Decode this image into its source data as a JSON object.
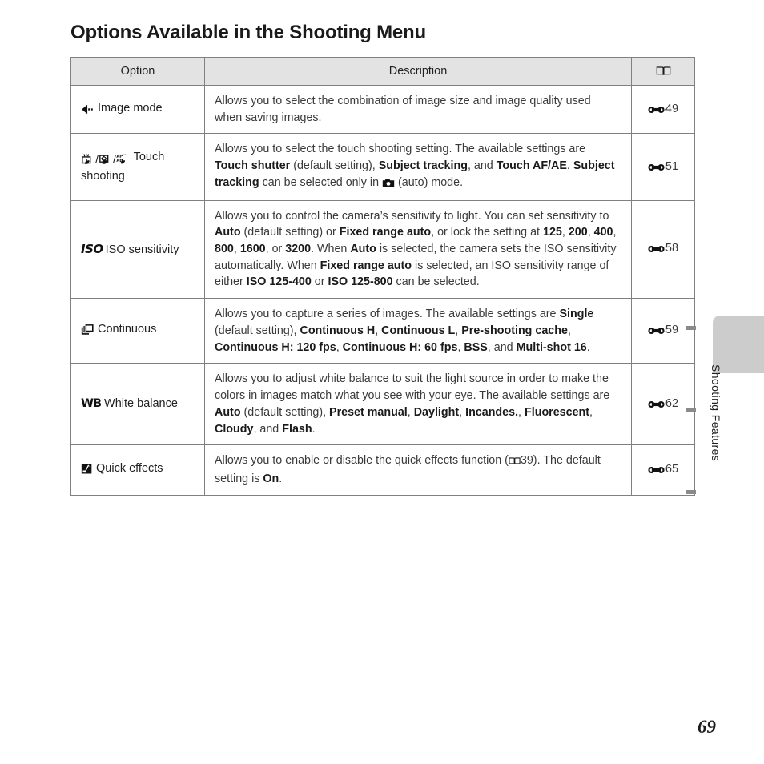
{
  "page": {
    "title": "Options Available in the Shooting Menu",
    "number": "69"
  },
  "side_tab": {
    "label": "Shooting Features"
  },
  "table": {
    "headers": {
      "option": "Option",
      "description": "Description",
      "reference": "book-icon"
    },
    "rows": [
      {
        "icon": "image-mode-icon",
        "option_label": "Image mode",
        "description_text": "Allows you to select the combination of image size and image quality used when saving images.",
        "reference": "49"
      },
      {
        "icon": "touch-shooting-icons",
        "option_label": "Touch shooting",
        "description_text": "Allows you to select the touch shooting setting. The available settings are Touch shutter (default setting), Subject tracking, and Touch AF/AE. Subject tracking can be selected only in (auto) mode.",
        "description_parts": [
          {
            "t": "Allows you to select the touch shooting setting. The available settings are ",
            "b": false
          },
          {
            "t": "Touch shutter",
            "b": true
          },
          {
            "t": " (default setting), ",
            "b": false
          },
          {
            "t": "Subject tracking",
            "b": true
          },
          {
            "t": ", and ",
            "b": false
          },
          {
            "t": "Touch AF/AE",
            "b": true
          },
          {
            "t": ". ",
            "b": false
          },
          {
            "t": "Subject tracking",
            "b": true
          },
          {
            "t": " can be selected only in ",
            "b": false
          },
          {
            "t": "[camera-icon]",
            "b": false
          },
          {
            "t": " (auto) mode.",
            "b": false
          }
        ],
        "reference": "51"
      },
      {
        "icon": "iso-icon",
        "option_label": "ISO sensitivity",
        "description_text": "Allows you to control the camera's sensitivity to light. You can set sensitivity to Auto (default setting) or Fixed range auto, or lock the setting at 125, 200, 400, 800, 1600, or 3200. When Auto is selected, the camera sets the ISO sensitivity automatically. When Fixed range auto is selected, an ISO sensitivity range of either ISO 125-400 or ISO 125-800 can be selected.",
        "reference": "58"
      },
      {
        "icon": "continuous-icon",
        "option_label": "Continuous",
        "description_text": "Allows you to capture a series of images. The available settings are Single (default setting), Continuous H, Continuous L, Pre-shooting cache, Continuous H: 120 fps, Continuous H: 60 fps, BSS, and Multi-shot 16.",
        "reference": "59"
      },
      {
        "icon": "white-balance-icon",
        "option_label": "White balance",
        "description_text": "Allows you to adjust white balance to suit the light source in order to make the colors in images match what you see with your eye. The available settings are Auto (default setting), Preset manual, Daylight, Incandes., Fluorescent, Cloudy, and Flash.",
        "reference": "62"
      },
      {
        "icon": "quick-effects-icon",
        "option_label": "Quick effects",
        "description_text": "Allows you to enable or disable the quick effects function (39). The default setting is On.",
        "inline_reference": "39",
        "reference": "65"
      }
    ]
  },
  "text_fragments": {
    "r1_d": "Allows you to select the combination of image size and image quality used when saving images.",
    "r2_p1": "Allows you to select the touch shooting setting. The available settings are ",
    "r2_b1": "Touch shutter",
    "r2_p2": " (default setting), ",
    "r2_b2": "Subject tracking",
    "r2_p3": ", and ",
    "r2_b3": "Touch AF/AE",
    "r2_p4": ". ",
    "r2_b4": "Subject tracking",
    "r2_p5": " can be selected only in ",
    "r2_p6": " (auto) mode.",
    "r3_p1": "Allows you to control the camera’s sensitivity to light. You can set sensitivity to ",
    "r3_b1": "Auto",
    "r3_p2": " (default setting) or ",
    "r3_b2": "Fixed range auto",
    "r3_p3": ", or lock the setting at ",
    "r3_b3": "125",
    "r3_p4": ", ",
    "r3_b4": "200",
    "r3_p5": ", ",
    "r3_b5": "400",
    "r3_p6": ", ",
    "r3_b6": "800",
    "r3_p7": ", ",
    "r3_b7": "1600",
    "r3_p8": ", or ",
    "r3_b8": "3200",
    "r3_p9": ". When ",
    "r3_b9": "Auto",
    "r3_p10": " is selected, the camera sets the ISO sensitivity automatically. When ",
    "r3_b10": "Fixed range auto",
    "r3_p11": " is selected, an ISO sensitivity range of either ",
    "r3_b11": "ISO 125-400",
    "r3_p12": " or ",
    "r3_b12": "ISO 125-800",
    "r3_p13": " can be selected.",
    "r4_p1": "Allows you to capture a series of images. The available settings are ",
    "r4_b1": "Single",
    "r4_p2": " (default setting), ",
    "r4_b2": "Continuous H",
    "r4_p3": ", ",
    "r4_b3": "Continuous L",
    "r4_p4": ", ",
    "r4_b4": "Pre-shooting cache",
    "r4_p5": ", ",
    "r4_b5": "Continuous H: 120 fps",
    "r4_p6": ", ",
    "r4_b6": "Continuous H: 60 fps",
    "r4_p7": ", ",
    "r4_b7": "BSS",
    "r4_p8": ", and ",
    "r4_b8": "Multi-shot 16",
    "r4_p9": ".",
    "r5_p1": "Allows you to adjust white balance to suit the light source in order to make the colors in images match what you see with your eye. The available settings are ",
    "r5_b1": "Auto",
    "r5_p2": " (default setting), ",
    "r5_b2": "Preset manual",
    "r5_p3": ", ",
    "r5_b3": "Daylight",
    "r5_p4": ", ",
    "r5_b4": "Incandes.",
    "r5_p5": ", ",
    "r5_b5": "Fluorescent",
    "r5_p6": ", ",
    "r5_b6": "Cloudy",
    "r5_p7": ", and ",
    "r5_b7": "Flash",
    "r5_p8": ".",
    "r6_p1": "Allows you to enable or disable the quick effects function (",
    "r6_p2": "39). The default setting is ",
    "r6_b1": "On",
    "r6_p3": "."
  }
}
